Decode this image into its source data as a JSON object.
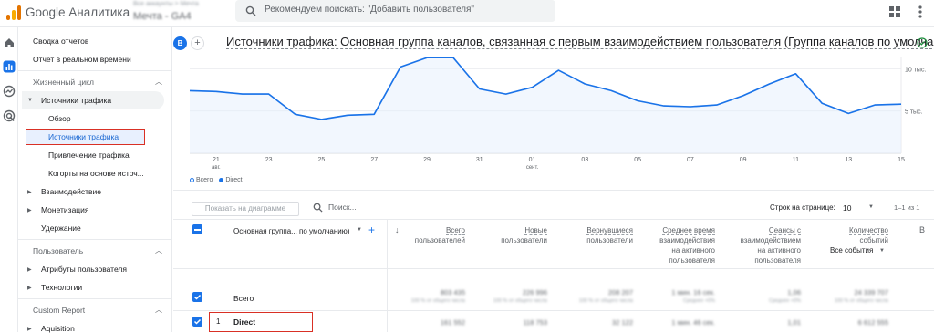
{
  "header": {
    "app_name": "Google Аналитика",
    "account_line": "Все аккаунты > Мечта",
    "property": "Мечта - GA4",
    "search_placeholder": "Рекомендуем поискать: \"Добавить пользователя\""
  },
  "rail_icons": [
    "home-icon",
    "reports-icon",
    "explore-icon",
    "advertising-icon"
  ],
  "nav": {
    "top_items": [
      "Сводка отчетов",
      "Отчет в реальном времени"
    ],
    "lifecycle": {
      "section": "Жизненный цикл",
      "traffic_group": "Источники трафика",
      "traffic_items": [
        "Обзор",
        "Источники трафика",
        "Привлечение трафика",
        "Когорты на основе источ..."
      ],
      "other_groups": [
        "Взаимодействие",
        "Монетизация"
      ],
      "retention": "Удержание"
    },
    "user": {
      "section": "Пользователь",
      "groups": [
        "Атрибуты пользователя",
        "Технологии"
      ]
    },
    "custom": {
      "section": "Custom Report",
      "groups": [
        "Aquisition"
      ]
    }
  },
  "page": {
    "avatar_letter": "B",
    "title": "Источники трафика: Основная группа каналов, связанная с первым взаимодействием пользователя (Группа каналов по умолчанию)"
  },
  "chart_data": {
    "type": "line",
    "x": [
      "20",
      "21",
      "22",
      "23",
      "24",
      "25",
      "26",
      "27",
      "28",
      "29",
      "30",
      "31",
      "01",
      "02",
      "03",
      "04",
      "05",
      "06",
      "07",
      "08",
      "09",
      "10",
      "11",
      "12",
      "13",
      "14",
      "15",
      "16"
    ],
    "x_tick_labels": [
      "21\nавг.",
      "23",
      "25",
      "27",
      "29",
      "31",
      "01\nсент.",
      "03",
      "05",
      "07",
      "09",
      "11",
      "13",
      "15"
    ],
    "y_tick_labels": [
      "10 тыс.",
      "5 тыс."
    ],
    "ylim": [
      0,
      11000
    ],
    "series": [
      {
        "name": "Всего",
        "values": [
          7400,
          7300,
          7000,
          7000,
          4600,
          4000,
          4500,
          4600,
          10200,
          11300,
          11300,
          7600,
          7000,
          7800,
          9800,
          8200,
          7400,
          6200,
          5600,
          5500,
          5700,
          6800,
          8200,
          9400,
          5900,
          4700,
          5700,
          5800
        ],
        "color": "#c6dafc"
      },
      {
        "name": "Direct",
        "values": [
          7400,
          7300,
          7000,
          7000,
          4600,
          4000,
          4500,
          4600,
          10200,
          11300,
          11300,
          7600,
          7000,
          7800,
          9800,
          8200,
          7400,
          6200,
          5600,
          5500,
          5700,
          6800,
          8200,
          9400,
          5900,
          4700,
          5700,
          5800
        ],
        "color": "#1a73e8"
      }
    ]
  },
  "legend": {
    "total": "Всего",
    "direct": "Direct"
  },
  "table_toolbar": {
    "show_on_chart": "Показать на диаграмме",
    "search_placeholder": "Поиск...",
    "rows_per_page_label": "Строк на странице:",
    "rows_per_page": "10",
    "pagination": "1–1 из 1"
  },
  "table": {
    "dimension_header": "Основная группа... по умолчанию)",
    "columns": [
      {
        "line1": "Всего",
        "line2": "пользователей"
      },
      {
        "line1": "Новые",
        "line2": "пользователи"
      },
      {
        "line1": "Вернувшиеся",
        "line2": "пользователи"
      },
      {
        "line1": "Среднее время",
        "line2": "взаимодействия",
        "line3": "на активного",
        "line4": "пользователя"
      },
      {
        "line1": "Сеансы с",
        "line2": "взаимодействием",
        "line3": "на активного",
        "line4": "пользователя"
      },
      {
        "line1": "Количество",
        "line2": "событий",
        "line3": "Все события"
      }
    ],
    "total_row": {
      "label": "Всего",
      "values": [
        "803 435",
        "226 996",
        "208 207",
        "1 мин. 16 сек.",
        "1,06",
        "24 339 707"
      ],
      "subs": [
        "100 % от общего числа",
        "100 % от общего числа",
        "100 % от общего числа",
        "Среднее +0%",
        "Среднее +0%",
        "100 % от общего числа"
      ]
    },
    "rows": [
      {
        "index": "1",
        "label": "Direct",
        "values": [
          "161 552",
          "118 753",
          "32 122",
          "1 мин. 46 сек.",
          "1,01",
          "6 612 555"
        ]
      }
    ]
  }
}
